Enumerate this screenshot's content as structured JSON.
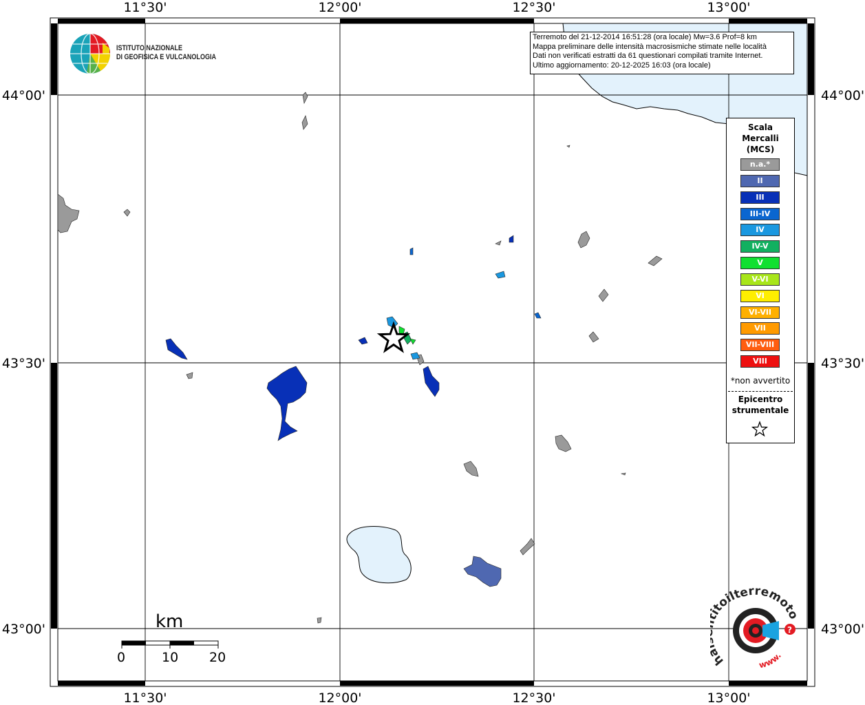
{
  "map": {
    "lon_labels": [
      "11°30'",
      "12°00'",
      "12°30'",
      "13°00'"
    ],
    "lat_labels": [
      "44°00'",
      "43°30'",
      "43°00'"
    ],
    "land_color": "#ffffff",
    "water_color": "#e3f2fc",
    "epicenter": {
      "lon": 12.07,
      "lat": 43.535,
      "icon": "star-icon"
    }
  },
  "header": {
    "line1": "Terremoto del 21-12-2014 16:51:28 (ora locale) Mw=3.6 Prof=8 km",
    "line2": "Mappa preliminare delle intensità macrosismiche stimate nelle località",
    "line3": "Dati non verificati estratti da 61 questionari compilati tramite Internet.",
    "line4": "Ultimo aggiornamento: 20-12-2025 16:03 (ora locale)"
  },
  "institute": {
    "line1": "ISTITUTO NAZIONALE",
    "line2": "DI GEOFISICA E VULCANOLOGIA"
  },
  "legend": {
    "title": [
      "Scala",
      "Mercalli",
      "(MCS)"
    ],
    "items": [
      {
        "label": "n.a.*",
        "color": "#9a9a9a"
      },
      {
        "label": "II",
        "color": "#4f68b1"
      },
      {
        "label": "III",
        "color": "#0830b7"
      },
      {
        "label": "III-IV",
        "color": "#0a66d0"
      },
      {
        "label": "IV",
        "color": "#1a98e0"
      },
      {
        "label": "IV-V",
        "color": "#12b060"
      },
      {
        "label": "V",
        "color": "#10e030"
      },
      {
        "label": "V-VI",
        "color": "#a8e61a"
      },
      {
        "label": "VI",
        "color": "#ffee00"
      },
      {
        "label": "VI-VII",
        "color": "#ffb000"
      },
      {
        "label": "VII",
        "color": "#ff9a00"
      },
      {
        "label": "VII-VIII",
        "color": "#ff5d10"
      },
      {
        "label": "VIII",
        "color": "#ee1010"
      }
    ],
    "na_note": "*non avvertito",
    "epicenter_label": [
      "Epicentro",
      "strumentale"
    ]
  },
  "scale_bar": {
    "unit": "km",
    "ticks": [
      "0",
      "10",
      "20"
    ]
  },
  "site_logo": {
    "text": "haisentitoilterremoto.it",
    "prefix": "www."
  }
}
